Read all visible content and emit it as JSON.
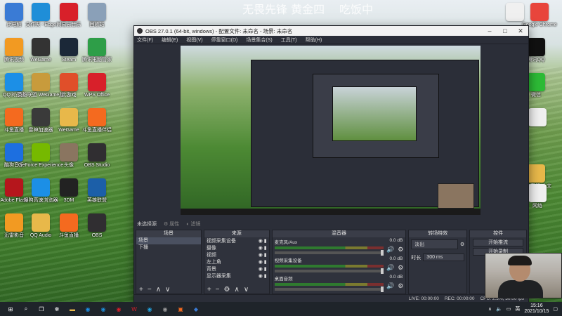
{
  "desktop": {
    "watermarks": [
      "无畏先锋 黄金四",
      "吃饭中"
    ],
    "icons_left": [
      {
        "label": "此电脑",
        "icon": "computer-icon",
        "color": "#3a7bd5"
      },
      {
        "label": "文件夹 - Edge",
        "icon": "edge-icon",
        "color": "#1f8ed8"
      },
      {
        "label": "网易云音乐",
        "icon": "netease-music-icon",
        "color": "#d8202a"
      },
      {
        "label": "回收站",
        "icon": "recycle-bin-icon",
        "color": "#8aa0b8"
      },
      {
        "label": "腾讯视频",
        "icon": "tencent-video-icon",
        "color": "#f29a22"
      },
      {
        "label": "WeGame",
        "icon": "wegame-icon",
        "color": "#333333"
      },
      {
        "label": "Steam",
        "icon": "steam-icon",
        "color": "#1b2838"
      },
      {
        "label": "腾讯电脑管家",
        "icon": "pc-manager-icon",
        "color": "#2e9e48"
      },
      {
        "label": "QQ浏览器",
        "icon": "qq-browser-icon",
        "color": "#1c8fe6"
      },
      {
        "label": "英雄联盟 WeGame版",
        "icon": "league-icon",
        "color": "#c89b3c"
      },
      {
        "label": "此游戏",
        "icon": "game-icon",
        "color": "#e04f2a"
      },
      {
        "label": "WPS Office",
        "icon": "wps-icon",
        "color": "#d8202a"
      },
      {
        "label": "斗鱼直播",
        "icon": "douyu-icon",
        "color": "#f46a1f"
      },
      {
        "label": "雷神加速器",
        "icon": "thunder-icon",
        "color": "#3a3a3a"
      },
      {
        "label": "WeGame",
        "icon": "folder-icon",
        "color": "#e8b84a"
      },
      {
        "label": "斗鱼直播伴侣",
        "icon": "douyu-companion-icon",
        "color": "#f46a1f"
      },
      {
        "label": "酷狗音乐",
        "icon": "kugou-icon",
        "color": "#1d6fe0"
      },
      {
        "label": "GeForce Experience",
        "icon": "nvidia-icon",
        "color": "#76b900"
      },
      {
        "label": "头像",
        "icon": "avatar-icon",
        "color": "#8a7560"
      },
      {
        "label": "OBS Studio",
        "icon": "obs-icon",
        "color": "#302e31"
      },
      {
        "label": "Adobe Flash",
        "icon": "flash-icon",
        "color": "#b5161c"
      },
      {
        "label": "搜狗高速浏览器",
        "icon": "sogou-icon",
        "color": "#1c8fe6"
      },
      {
        "label": "3DM",
        "icon": "3dm-icon",
        "color": "#222222"
      },
      {
        "label": "英雄联盟",
        "icon": "league-icon-2",
        "color": "#1c5fa8"
      },
      {
        "label": "迅雷影音",
        "icon": "xunlei-icon",
        "color": "#f29a22"
      },
      {
        "label": "QQ Audio",
        "icon": "folder-icon-2",
        "color": "#e8b84a"
      },
      {
        "label": "斗鱼直播",
        "icon": "douyu-icon-2",
        "color": "#f46a1f"
      },
      {
        "label": "OBS",
        "icon": "obs-icon-2",
        "color": "#302e31"
      }
    ],
    "icons_right": [
      {
        "label": "",
        "icon": "document-icon",
        "color": "#f0f0f0"
      },
      {
        "label": "Google Chrome",
        "icon": "chrome-icon",
        "color": "#e8453c"
      },
      {
        "label": "腾讯QQ",
        "icon": "qq-icon",
        "color": "#111111"
      },
      {
        "label": "微信",
        "icon": "wechat-icon",
        "color": "#2dbb36"
      },
      {
        "label": "",
        "icon": "document-icon-2",
        "color": "#f0f0f0"
      },
      {
        "label": "网络直播 大文",
        "icon": "folder-icon-3",
        "color": "#e8b84a"
      },
      {
        "label": "网络",
        "icon": "network-icon",
        "color": "#f0f0f0"
      }
    ]
  },
  "obs": {
    "title": "OBS 27.0.1 (64-bit, windows) - 配置文件: 未命名 - 场景: 未命名",
    "menu": [
      "文件(F)",
      "编辑(E)",
      "视图(V)",
      "停靠窗口(D)",
      "场景集合(S)",
      "工具(T)",
      "帮助(H)"
    ],
    "source_status": "未选择源",
    "properties_label": "属性",
    "filters_label": "滤镜",
    "docks": {
      "scenes": {
        "title": "场景",
        "items": [
          "场景",
          "下播"
        ]
      },
      "sources": {
        "title": "来源",
        "items": [
          "视频采集设备",
          "摄像",
          "视频",
          "左上角",
          "背景",
          "显示器采集"
        ]
      },
      "mixer": {
        "title": "混音器",
        "channels": [
          {
            "name": "麦克风/Aux",
            "db": "0.0 dB"
          },
          {
            "name": "视频采集设备",
            "db": "0.0 dB"
          },
          {
            "name": "桌面音频",
            "db": "0.0 dB"
          }
        ]
      },
      "transitions": {
        "title": "转场特效",
        "type": "淡出",
        "duration_label": "时长",
        "duration": "300 ms"
      },
      "controls": {
        "title": "控件",
        "start_stream": "开始推流",
        "start_record": "开始录制"
      }
    },
    "status": {
      "live": "LIVE: 00:00:00",
      "rec": "REC: 00:00:00",
      "cpu": "CPU: 2.3%, 30.00 fps"
    }
  },
  "taskbar": {
    "time": "15:16",
    "date": "2021/10/15",
    "ime": "英",
    "apps": [
      {
        "icon": "windows-start-icon",
        "glyph": "⊞",
        "color": "#ffffff"
      },
      {
        "icon": "search-icon",
        "glyph": "⌕",
        "color": "#ffffff"
      },
      {
        "icon": "task-view-icon",
        "glyph": "❐",
        "color": "#ffffff"
      },
      {
        "icon": "puzzle-icon",
        "glyph": "✻",
        "color": "#ffffff"
      },
      {
        "icon": "folder-taskbar-icon",
        "glyph": "▬",
        "color": "#e8b84a"
      },
      {
        "icon": "qq-browser-taskbar-icon",
        "glyph": "◉",
        "color": "#1c8fe6"
      },
      {
        "icon": "edge-taskbar-icon",
        "glyph": "◉",
        "color": "#1f8ed8"
      },
      {
        "icon": "netease-taskbar-icon",
        "glyph": "◉",
        "color": "#d8202a"
      },
      {
        "icon": "wps-taskbar-icon",
        "glyph": "W",
        "color": "#d8202a"
      },
      {
        "icon": "edge-taskbar-icon-2",
        "glyph": "◉",
        "color": "#22a3e0"
      },
      {
        "icon": "obs-taskbar-icon",
        "glyph": "◉",
        "color": "#9a9a9a"
      },
      {
        "icon": "douyu-taskbar-icon",
        "glyph": "▣",
        "color": "#f46a1f"
      },
      {
        "icon": "shield-taskbar-icon",
        "glyph": "◆",
        "color": "#3a7bd5"
      }
    ]
  }
}
